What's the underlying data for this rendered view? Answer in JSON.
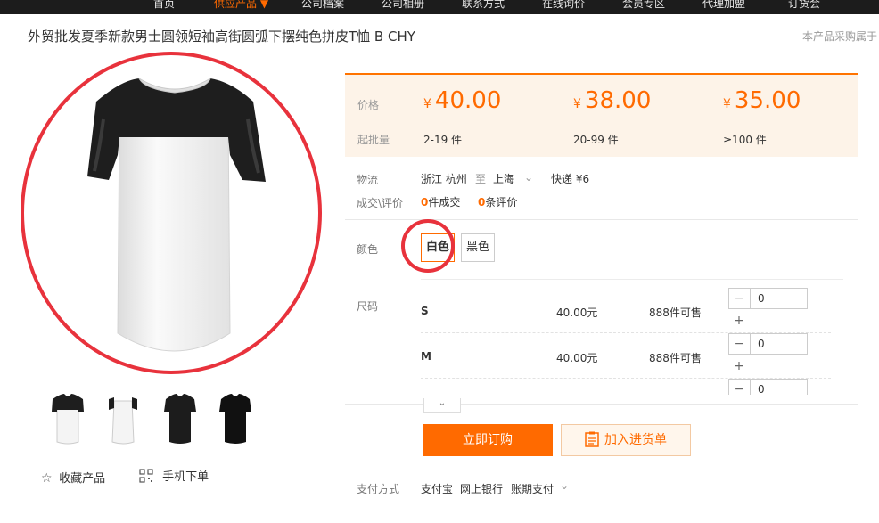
{
  "nav": {
    "items": [
      {
        "label": "首页",
        "active": false
      },
      {
        "label": "供应产品 ▼",
        "active": true
      },
      {
        "label": "公司档案",
        "active": false
      },
      {
        "label": "公司相册",
        "active": false
      },
      {
        "label": "联系方式",
        "active": false
      },
      {
        "label": "在线询价",
        "active": false
      },
      {
        "label": "会员专区",
        "active": false
      },
      {
        "label": "代理加盟",
        "active": false
      },
      {
        "label": "订货会",
        "active": false
      }
    ]
  },
  "product": {
    "title": "外贸批发夏季新款男士圆领短袖高街圆弧下摆纯色拼皮T恤 B CHY",
    "purchase_note": "本产品采购属于"
  },
  "gallery": {
    "favorite_label": "收藏产品",
    "mobile_label": "手机下单"
  },
  "pricing": {
    "price_label": "价格",
    "moq_label": "起批量",
    "currency": "¥",
    "tiers": [
      {
        "price": "40.00",
        "range": "2-19 件"
      },
      {
        "price": "38.00",
        "range": "20-99 件"
      },
      {
        "price": "35.00",
        "range": "≥100 件"
      }
    ]
  },
  "logistics": {
    "label": "物流",
    "from": "浙江 杭州",
    "to_word": "至",
    "to": "上海",
    "shipping": "快递 ¥6"
  },
  "deals": {
    "label": "成交\\评价",
    "deal_count": "0",
    "deal_text": "件成交",
    "review_count": "0",
    "review_text": "条评价"
  },
  "color": {
    "label": "颜色",
    "options": [
      "白色",
      "黑色"
    ],
    "selected": "白色"
  },
  "size": {
    "label": "尺码",
    "rows": [
      {
        "name": "S",
        "price": "40.00元",
        "stock": "888件可售",
        "qty": "0"
      },
      {
        "name": "M",
        "price": "40.00元",
        "stock": "888件可售",
        "qty": "0"
      },
      {
        "qty": "0"
      }
    ]
  },
  "actions": {
    "buy_label": "立即订购",
    "cart_label": "加入进货单"
  },
  "payment": {
    "label": "支付方式",
    "methods": [
      "支付宝",
      "网上银行",
      "账期支付"
    ]
  },
  "colors": {
    "accent": "#ff6a00",
    "annotation": "#e8323c"
  }
}
